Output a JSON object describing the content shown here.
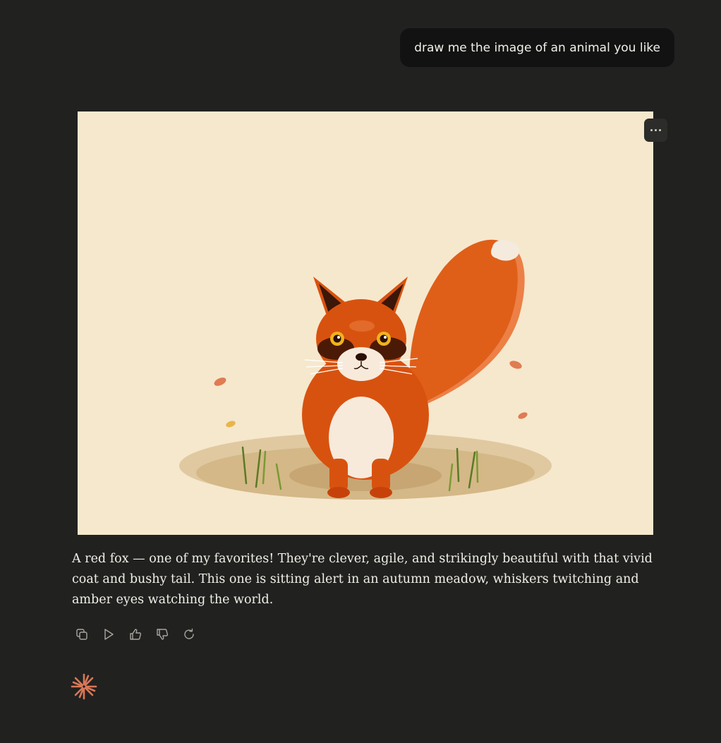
{
  "user_message": {
    "text": "draw me the image of an animal you like"
  },
  "artifact": {
    "subject": "red fox",
    "menu_icon": "ellipsis-icon",
    "colors": {
      "background": "#f6e8cd",
      "fur": "#d8520f",
      "tail": "#e0601a",
      "cream": "#f7eadb",
      "ear_inner": "#3a1708",
      "eye": "#f0b31c",
      "ground_outer": "#e0c9a0",
      "ground_inner": "#cfb180",
      "grass": "#5a7a25",
      "leaf": "#e07b52"
    }
  },
  "response": {
    "text": "A red fox — one of my favorites! They're clever, agile, and strikingly beautiful with that vivid coat and bushy tail. This one is sitting alert in an autumn meadow, whiskers twitching and amber eyes watching the world."
  },
  "actions": [
    {
      "icon": "copy-icon"
    },
    {
      "icon": "play-icon"
    },
    {
      "icon": "thumbs-up-icon"
    },
    {
      "icon": "thumbs-down-icon"
    },
    {
      "icon": "retry-icon"
    }
  ],
  "brand": {
    "icon": "spark-logo-icon",
    "color": "#d97757"
  }
}
